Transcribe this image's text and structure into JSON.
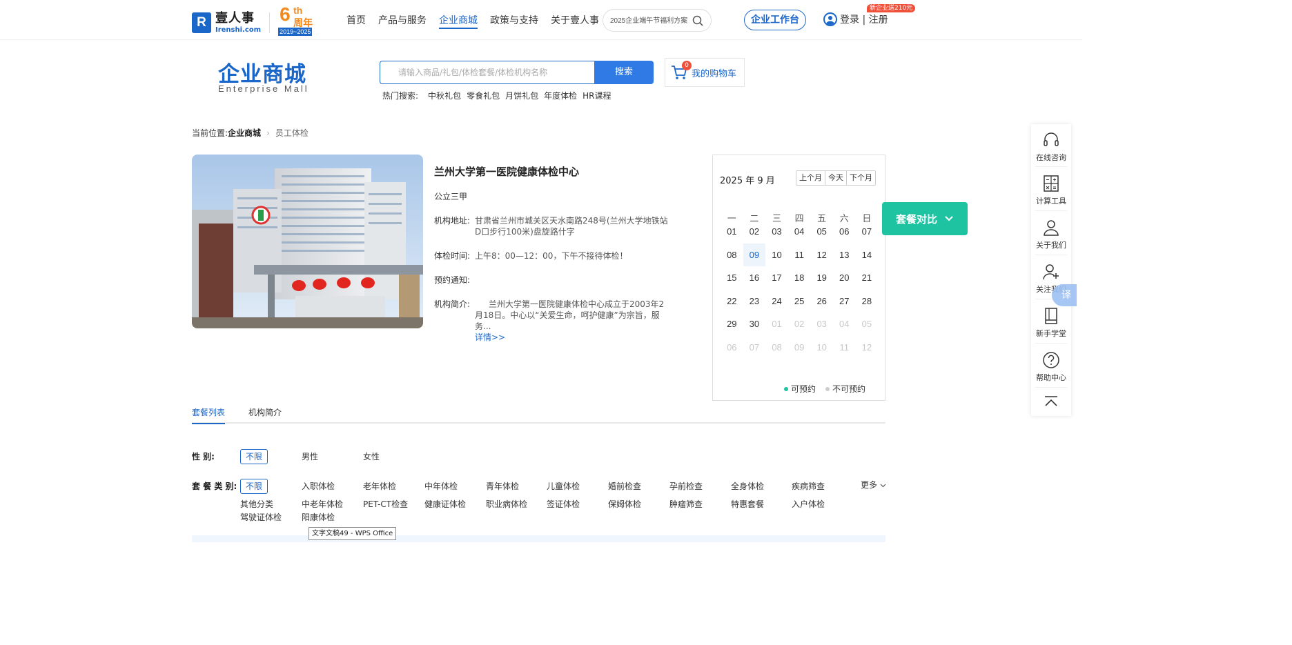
{
  "header": {
    "logo_cn": "壹人事",
    "logo_en": "Irenshi.com",
    "logo_mark": "R",
    "anniv_num": "6",
    "anniv_th": "th",
    "anniv_cn": "周年",
    "anniv_years": "2019~2025",
    "nav": [
      "首页",
      "产品与服务",
      "企业商城",
      "政策与支持",
      "关于壹人事"
    ],
    "search_placeholder": "2025企业端午节福利方案",
    "workbench": "企业工作台",
    "login": "登录 | 注册",
    "promo_badge": "新企业送210元"
  },
  "mall": {
    "title": "企业商城",
    "subtitle": "Enterprise  Mall",
    "search_placeholder": "请输入商品/礼包/体检套餐/体检机构名称",
    "search_button": "搜索",
    "cart_count": "0",
    "cart_label": "我的购物车",
    "hot_label": "热门搜索:",
    "hot_items": [
      "中秋礼包",
      "零食礼包",
      "月饼礼包",
      "年度体检",
      "HR课程"
    ]
  },
  "breadcrumb": {
    "prefix": "当前位置:",
    "items": [
      "企业商城",
      "员工体检"
    ]
  },
  "institution": {
    "name": "兰州大学第一医院健康体检中心",
    "level": "公立三甲",
    "address_label": "机构地址:",
    "address": "甘肃省兰州市城关区天水南路248号(兰州大学地铁站D口步行100米)盘旋路什字",
    "hours_label": "体检时间:",
    "hours": "上午8：00—12：00，下午不接待体检！",
    "notice_label": "预约通知:",
    "notice": "",
    "intro_label": "机构简介:",
    "intro": "兰州大学第一医院健康体检中心成立于2003年2月18日。中心以“关爱生命，呵护健康”为宗旨，服务...",
    "details_link": "详情>>"
  },
  "calendar": {
    "title": "2025 年 9 月",
    "buttons": [
      "上个月",
      "今天",
      "下个月"
    ],
    "weekdays": [
      "一",
      "二",
      "三",
      "四",
      "五",
      "六",
      "日"
    ],
    "days": [
      [
        "01",
        "02",
        "03",
        "04",
        "05",
        "06",
        "07"
      ],
      [
        "08",
        "09",
        "10",
        "11",
        "12",
        "13",
        "14"
      ],
      [
        "15",
        "16",
        "17",
        "18",
        "19",
        "20",
        "21"
      ],
      [
        "22",
        "23",
        "24",
        "25",
        "26",
        "27",
        "28"
      ],
      [
        "29",
        "30",
        "01",
        "02",
        "03",
        "04",
        "05"
      ],
      [
        "06",
        "07",
        "08",
        "09",
        "10",
        "11",
        "12"
      ]
    ],
    "today": "09",
    "legend_available": "可预约",
    "legend_unavailable": "不可预约",
    "colors": {
      "available": "#1ec4a2",
      "unavailable": "#cccccc"
    }
  },
  "compare_button": "套餐对比",
  "tabs": [
    "套餐列表",
    "机构简介"
  ],
  "filters": {
    "gender_label": "性      别:",
    "gender_options": [
      "不限",
      "男性",
      "女性"
    ],
    "package_label": "套 餐 类 别:",
    "package_row1": [
      "不限",
      "入职体检",
      "老年体检",
      "中年体检",
      "青年体检",
      "儿童体检",
      "婚前检查",
      "孕前检查",
      "全身体检",
      "疾病筛查"
    ],
    "package_row2": [
      "其他分类",
      "中老年体检",
      "PET-CT检查",
      "健康证体检",
      "职业病体检",
      "签证体检",
      "保姆体检",
      "肿瘤筛查",
      "特惠套餐",
      "入户体检"
    ],
    "package_row3": [
      "驾驶证体检",
      "阳康体检"
    ],
    "more": "更多"
  },
  "tooltip": "文字文稿49 - WPS Office",
  "sidebar": {
    "items": [
      "在线咨询",
      "计算工具",
      "关于我们",
      "关注我们",
      "新手学堂",
      "帮助中心"
    ],
    "translate": "译"
  },
  "colors": {
    "primary": "#1a66c9",
    "accent": "#1ec4a2",
    "brand_orange": "#f08a1c",
    "red": "#f04f3a"
  }
}
